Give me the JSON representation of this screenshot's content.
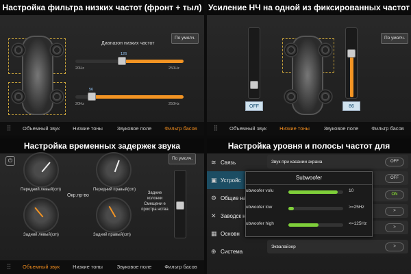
{
  "colors": {
    "accent": "#f39423",
    "active_tab": "#f08c1e",
    "toggle_on": "#99ff33"
  },
  "q1": {
    "title": "Настройка фильтра низких частот (фронт + тыл)",
    "default_button": "По умолч.",
    "range_label": "Диапазон низких частот",
    "front": {
      "value": "126",
      "min": "20Hz",
      "max": "250Hz"
    },
    "rear": {
      "value": "56",
      "min": "20Hz",
      "max": "250Hz"
    },
    "tabs": [
      "Объемный звук",
      "Низкие тоны",
      "Звуковое поле",
      "Фильтр басов"
    ],
    "active_tab": 3
  },
  "q2": {
    "title": "Усиление НЧ на одной из фиксированных частот",
    "default_button": "По умолч.",
    "left_value": "OFF",
    "right_value": "86",
    "tabs": [
      "Объемный звук",
      "Низкие тоны",
      "Звуковое поле",
      "Фильтр басов"
    ],
    "active_tab": 1
  },
  "q3": {
    "title": "Настройка временных задержек звука",
    "default_button": "По умолч.",
    "dials": [
      "Передний левый(cm)",
      "Передний правый(cm)",
      "Задний левый(cm)",
      "Задний правый(cm)"
    ],
    "center_label": "Окр.пр-во",
    "rear_text": "Задние колонки Смещени е простра нства",
    "tabs": [
      "Объемный звук",
      "Низкие тоны",
      "Звуковое поле",
      "Фильтр басов"
    ],
    "active_tab": 0
  },
  "q4": {
    "title": "Настройка уровня и полосы частот для сабвуфера",
    "menu": [
      "Связь",
      "Устройс",
      "Общие настрой",
      "Заводск настрой",
      "Основн",
      "Система"
    ],
    "rows": [
      {
        "label": "Звук при касании экрана",
        "state": "OFF"
      },
      {
        "label": "",
        "state": "OFF"
      },
      {
        "label": "",
        "state": "ON"
      },
      {
        "label": "",
        "state": ">"
      },
      {
        "label": "",
        "state": ">"
      },
      {
        "label": "Эквалайзер",
        "state": ">"
      }
    ],
    "popup": {
      "title": "Subwoofer",
      "rows": [
        {
          "label": "ubwoofer volu",
          "value": "10",
          "level": 0.9
        },
        {
          "label": "ubwoofer low",
          "value": ">=25Hz",
          "level": 0.1
        },
        {
          "label": "ubwoofer high",
          "value": "<=125Hz",
          "level": 0.55
        }
      ]
    }
  }
}
